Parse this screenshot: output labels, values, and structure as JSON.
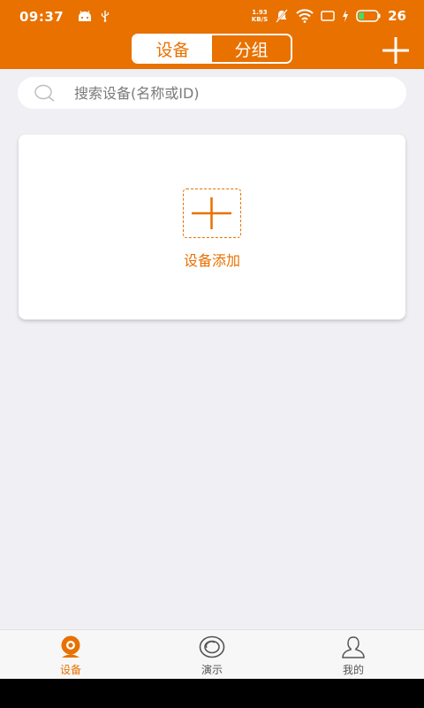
{
  "status_bar": {
    "time": "09:37",
    "net_speed_value": "1.93",
    "net_speed_unit": "KB/S",
    "battery": "26"
  },
  "header": {
    "tabs": [
      {
        "label": "设备",
        "active": true
      },
      {
        "label": "分组",
        "active": false
      }
    ],
    "add_icon": "plus-icon"
  },
  "search": {
    "placeholder": "搜索设备(名称或ID)",
    "value": ""
  },
  "card": {
    "add_label": "设备添加"
  },
  "bottom_nav": {
    "items": [
      {
        "label": "设备",
        "icon": "camera-icon",
        "active": true
      },
      {
        "label": "演示",
        "icon": "demo-icon",
        "active": false
      },
      {
        "label": "我的",
        "icon": "user-icon",
        "active": false
      }
    ]
  },
  "colors": {
    "accent": "#e87100",
    "background": "#f0eff4"
  }
}
